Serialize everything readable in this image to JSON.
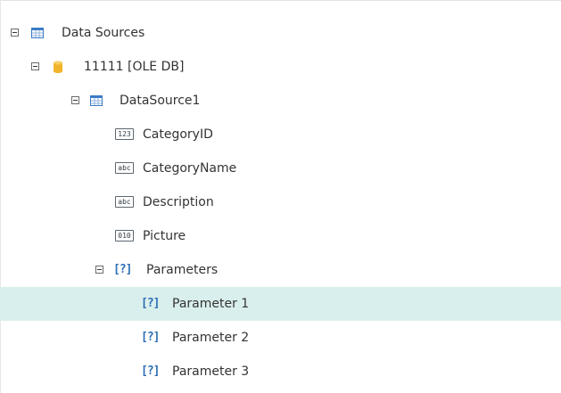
{
  "tree": {
    "root": {
      "label": "Data Sources"
    },
    "connection": {
      "label": "11111 [OLE DB]"
    },
    "datasource": {
      "label": "DataSource1"
    },
    "fields": [
      {
        "label": "CategoryID",
        "type_badge": "123"
      },
      {
        "label": "CategoryName",
        "type_badge": "abc"
      },
      {
        "label": "Description",
        "type_badge": "abc"
      },
      {
        "label": "Picture",
        "type_badge": "010"
      }
    ],
    "parameters": {
      "label": "Parameters",
      "icon_text": "[?]",
      "items": [
        {
          "label": "Parameter 1",
          "icon_text": "[?]",
          "selected": true
        },
        {
          "label": "Parameter 2",
          "icon_text": "[?]",
          "selected": false
        },
        {
          "label": "Parameter 3",
          "icon_text": "[?]",
          "selected": false
        }
      ]
    }
  },
  "colors": {
    "selection_bg": "#d9efed",
    "param_icon": "#2f6fb5",
    "db_icon": "#f2b32a",
    "table_icon": "#3b7bc8"
  }
}
